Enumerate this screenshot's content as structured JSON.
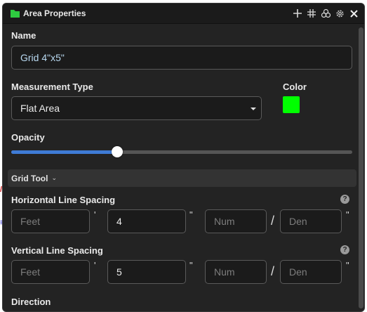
{
  "window": {
    "title": "Area Properties"
  },
  "toolbar": {
    "icons": [
      "plus-icon",
      "grid-icon",
      "overlap-circles-icon",
      "settings-icon",
      "close-icon"
    ]
  },
  "name": {
    "label": "Name",
    "value": "Grid 4\"x5\""
  },
  "measurement_type": {
    "label": "Measurement Type",
    "selected": "Flat Area"
  },
  "color": {
    "label": "Color",
    "value": "#00ff00"
  },
  "opacity": {
    "label": "Opacity",
    "value_fraction": 0.31
  },
  "grid_tool": {
    "label": "Grid Tool"
  },
  "horizontal": {
    "label": "Horizontal Line Spacing",
    "feet_placeholder": "Feet",
    "feet_value": "",
    "feet_symbol": "'",
    "inches_value": "4",
    "inches_symbol": "\"",
    "num_placeholder": "Num",
    "slash": "/",
    "den_placeholder": "Den",
    "den_symbol": "\""
  },
  "vertical": {
    "label": "Vertical Line Spacing",
    "feet_placeholder": "Feet",
    "feet_value": "",
    "feet_symbol": "'",
    "inches_value": "5",
    "inches_symbol": "\"",
    "num_placeholder": "Num",
    "slash": "/",
    "den_placeholder": "Den",
    "den_symbol": "\""
  },
  "direction": {
    "label": "Direction"
  },
  "help_glyph": "?"
}
